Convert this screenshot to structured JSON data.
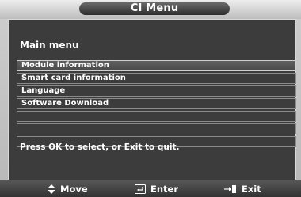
{
  "window": {
    "title": "CI Menu"
  },
  "main": {
    "section_title": "Main menu",
    "items": [
      {
        "label": "Module information",
        "selected": true
      },
      {
        "label": "Smart card information",
        "selected": false
      },
      {
        "label": "Language",
        "selected": false
      },
      {
        "label": "Software Download",
        "selected": false
      },
      {
        "label": "",
        "selected": false
      },
      {
        "label": "",
        "selected": false
      },
      {
        "label": "",
        "selected": false
      }
    ],
    "hint": "Press OK to select, or Exit to quit."
  },
  "footer": {
    "move_label": "Move",
    "enter_label": "Enter",
    "exit_label": "Exit",
    "move_icon": "up-down-arrow-icon",
    "enter_icon": "enter-icon",
    "exit_icon": "exit-icon"
  },
  "colors": {
    "panel_bg": "#3c3c3c",
    "title_pill": "#2e2e2e",
    "text": "#ffffff",
    "frame": "#c4c4c4"
  }
}
